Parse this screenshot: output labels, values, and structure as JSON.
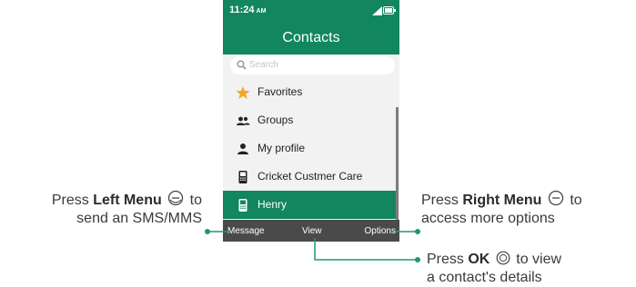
{
  "status_bar": {
    "time": "11:24",
    "ampm": "AM"
  },
  "header": {
    "title": "Contacts"
  },
  "search": {
    "placeholder": "Search"
  },
  "list": {
    "items": [
      {
        "label": "Favorites",
        "icon": "star-icon",
        "selected": false
      },
      {
        "label": "Groups",
        "icon": "groups-icon",
        "selected": false
      },
      {
        "label": "My profile",
        "icon": "person-icon",
        "selected": false
      },
      {
        "label": "Cricket Custmer Care",
        "icon": "phone-icon",
        "selected": false
      },
      {
        "label": "Henry",
        "icon": "phone-icon",
        "selected": true
      }
    ]
  },
  "softkeys": {
    "left": "Message",
    "center": "View",
    "right": "Options"
  },
  "callouts": {
    "left": {
      "press": "Press",
      "key": "Left Menu",
      "to": "to",
      "line2": "send an SMS/MMS"
    },
    "right": {
      "press": "Press",
      "key": "Right Menu",
      "to": "to",
      "line2": "access more options"
    },
    "ok": {
      "press": "Press",
      "key": "OK",
      "to": "to view",
      "line2": "a contact's details"
    }
  },
  "colors": {
    "accent": "#11865f",
    "softkey_bar": "#4a4a4a",
    "star": "#f5a623",
    "list_bg": "#f2f2f2"
  }
}
